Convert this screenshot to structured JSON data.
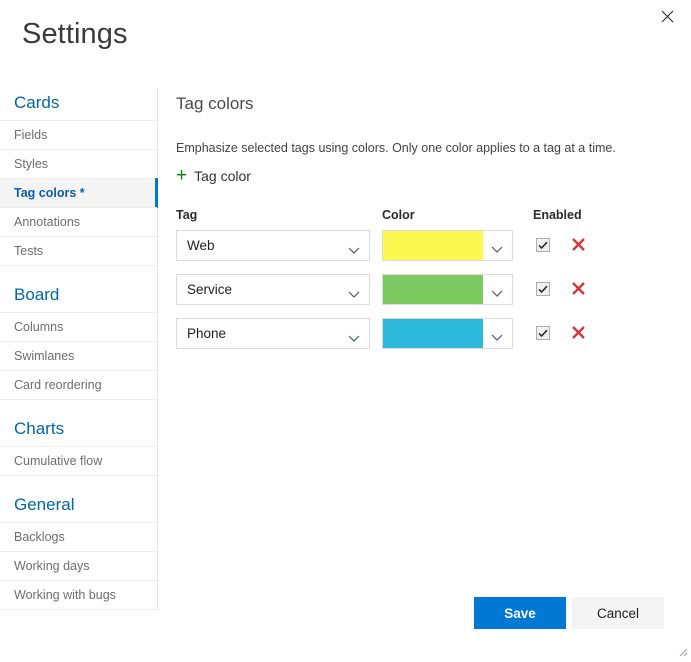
{
  "dialog": {
    "title": "Settings",
    "close_icon": "close-icon"
  },
  "sidebar": {
    "groups": [
      {
        "title": "Cards",
        "items": [
          {
            "label": "Fields",
            "selected": false
          },
          {
            "label": "Styles",
            "selected": false
          },
          {
            "label": "Tag colors *",
            "selected": true
          },
          {
            "label": "Annotations",
            "selected": false
          },
          {
            "label": "Tests",
            "selected": false
          }
        ]
      },
      {
        "title": "Board",
        "items": [
          {
            "label": "Columns",
            "selected": false
          },
          {
            "label": "Swimlanes",
            "selected": false
          },
          {
            "label": "Card reordering",
            "selected": false
          }
        ]
      },
      {
        "title": "Charts",
        "items": [
          {
            "label": "Cumulative flow",
            "selected": false
          }
        ]
      },
      {
        "title": "General",
        "items": [
          {
            "label": "Backlogs",
            "selected": false
          },
          {
            "label": "Working days",
            "selected": false
          },
          {
            "label": "Working with bugs",
            "selected": false
          }
        ]
      }
    ]
  },
  "main": {
    "section_title": "Tag colors",
    "description": "Emphasize selected tags using colors. Only one color applies to a tag at a time.",
    "add_tag_color": {
      "label": "Tag color",
      "plus_glyph": "+",
      "icon": "plus-icon"
    },
    "table": {
      "headers": {
        "tag": "Tag",
        "color": "Color",
        "enabled": "Enabled"
      },
      "rows": [
        {
          "tag": "Web",
          "color": "#fbf850",
          "enabled": true,
          "delete_icon": "delete-x-icon"
        },
        {
          "tag": "Service",
          "color": "#7cca5f",
          "enabled": true,
          "delete_icon": "delete-x-icon"
        },
        {
          "tag": "Phone",
          "color": "#2cb8da",
          "enabled": true,
          "delete_icon": "delete-x-icon"
        }
      ]
    }
  },
  "footer": {
    "save_label": "Save",
    "cancel_label": "Cancel"
  },
  "colors": {
    "accent": "#0078d4",
    "link": "#0366a8",
    "add_green": "#107c10",
    "delete_red": "#d13438"
  }
}
